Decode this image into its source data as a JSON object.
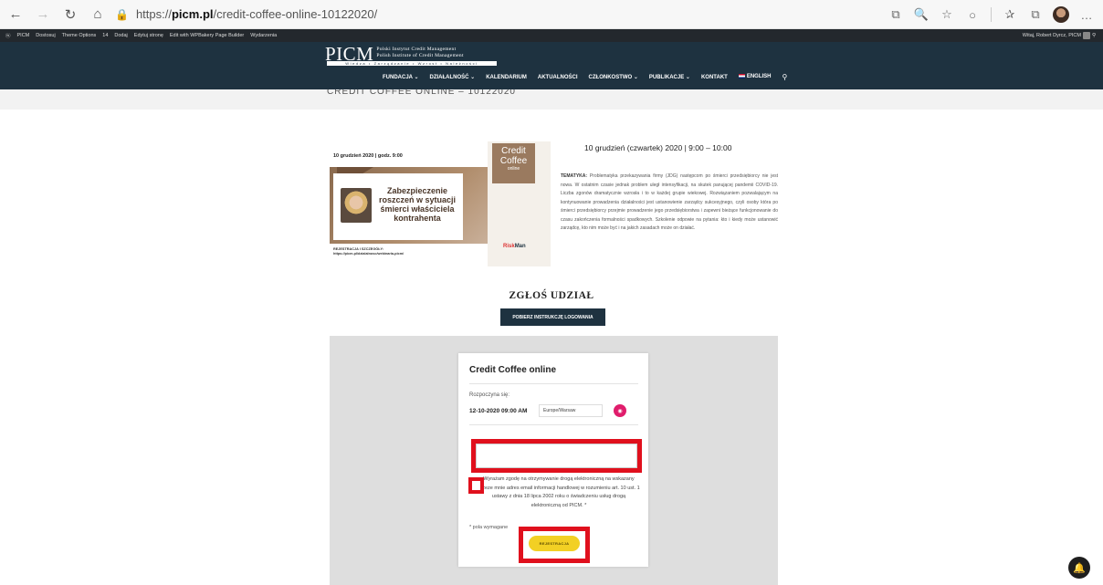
{
  "browser": {
    "back_icon": "←",
    "forward_icon": "→",
    "refresh_icon": "↻",
    "home_icon": "⌂",
    "lock_icon": "🔒",
    "url_prefix": "https://",
    "url_host": "picm.pl",
    "url_path": "/credit-coffee-online-10122020/",
    "right_icons": [
      "⧉",
      "🔍",
      "☆",
      "○",
      "✰",
      "⧉",
      "…"
    ]
  },
  "admin_bar": {
    "items": [
      "PICM",
      "Dostosuj",
      "Theme Options",
      "14",
      "Dodaj",
      "Edytuj stronę",
      "Edit with WPBakery Page Builder",
      "Wydarzenia"
    ],
    "greeting": "Witaj, Robert Dyrcz, PICM"
  },
  "header": {
    "logo_mark": "PICM",
    "logo_line1": "Polski Instytut Credit Management",
    "logo_line2": "Polish Institute of Credit Management",
    "logo_strip": "Wiedza • Zarządzanie • Wzrost • Należności",
    "nav": [
      "FUNDACJA ⌄",
      "DZIAŁALNOŚĆ ⌄",
      "KALENDARIUM",
      "AKTUALNOŚCI",
      "CZŁONKOSTWO ⌄",
      "PUBLIKACJE ⌄",
      "KONTAKT",
      "ENGLISH"
    ],
    "search_icon": "⚲"
  },
  "page_title": "CREDIT COFFEE ONLINE – 10122020",
  "event": {
    "banner_date": "10 grudzień 2020 | godz. 9:00",
    "banner_brand": "Credit",
    "banner_brand2": "Coffee",
    "banner_brand3": "online",
    "banner_title": "Zabezpieczenie roszczeń w sytuacji śmierci właściciela kontrahenta",
    "banner_reg1": "REJESTRACJA I SZCZEGÓŁY:",
    "banner_reg2": "https://picm.pl/dzialalnosc/webinaria-picm/",
    "banner_sponsor_a": "Risk",
    "banner_sponsor_b": "Man",
    "date_line": "10 grudzień (czwartek) 2020 | 9:00 – 10:00",
    "desc_label": "TEMATYKA:",
    "desc_text": " Problematyka przekazywania firmy (JDG) następcom po śmierci przedsiębiorcy nie jest nowa. W ostatnim czasie jednak problem uległ intensyfikacji, na skutek panującej pandemii COVID-19. Liczba zgonów dramatycznie wzrosła i to w każdej grupie wiekowej. Rozwiązaniem pozwalającym na kontynuowanie prowadzenia działalności jest ustanowienie zarządcy sukcesyjnego, czyli osoby która po śmierci przedsiębiorcy przejmie prowadzenie jego przedsiębiorstwa i zapewni bieżące funkcjonowanie do czasu zakończenia formalności spadkowych. Szkolenie odpowie na pytania: kto i kiedy może ustanowić zarządcę, kto nim może być i na jakich zasadach może on działać."
  },
  "signup": {
    "heading": "ZGŁOŚ UDZIAŁ",
    "instructions_button": "POBIERZ INSTRUKCJĘ LOGOWANIA"
  },
  "form": {
    "title": "Credit Coffee online",
    "starts_label": "Rozpoczyna się:",
    "datetime": "12-10-2020 09:00 AM",
    "timezone": "Europe/Warsaw",
    "tz_button_icon": "◉",
    "email_value": "",
    "email_placeholder": "",
    "consent_text": "Wyrażam zgodę na otrzymywanie drogą elektroniczną na wskazany przeze mnie adres email informacji handlowej w rozumieniu art. 10 ust. 1 ustawy z dnia 18 lipca 2002 roku o świadczeniu usług drogą elektroniczną od PICM. *",
    "required_note": "* pola wymagane",
    "submit_label": "REJESTRACJA"
  },
  "fab_icon": "🔔"
}
